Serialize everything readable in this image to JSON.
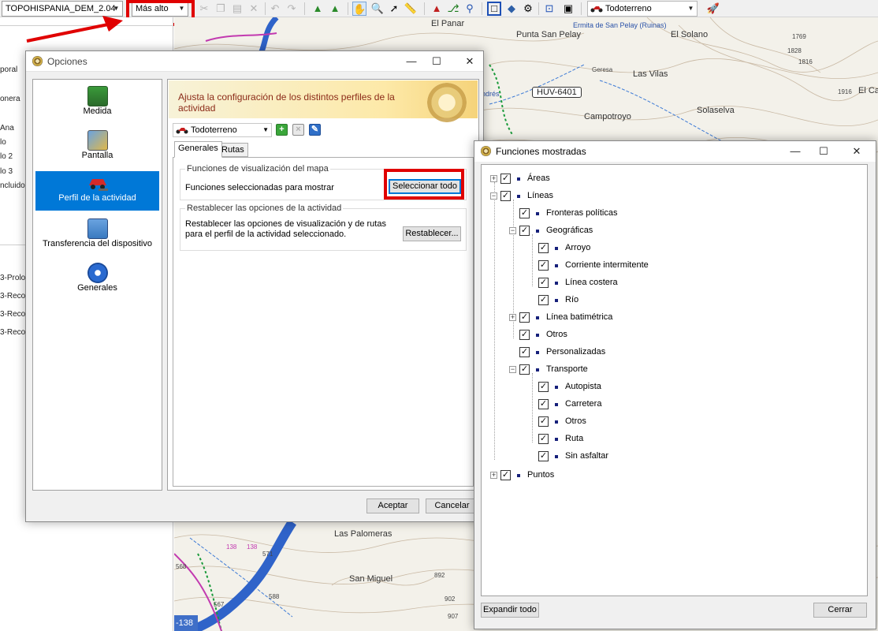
{
  "toolbar": {
    "map_combo": "TOPOHISPANIA_DEM_2.04",
    "detail_combo": "Más alto",
    "profile_combo": "Todoterreno"
  },
  "left_panel": {
    "rows_top": [
      "poral",
      "onera",
      "Ana",
      "lo",
      "lo 2",
      "lo 3",
      "ncluido"
    ],
    "rows_bottom": [
      "3-Prolo",
      "3-Reco",
      "3-Reco",
      "3-Reco"
    ]
  },
  "map": {
    "labels": [
      "El Panar",
      "Punta San Pelay",
      "Ermita de San Pelay (Ruinas)",
      "El Solano",
      "Geresa",
      "Las Vilas",
      "Campotroyo",
      "Solaselva",
      "El Ca",
      "Las Palomeras",
      "San Miguel",
      "ndrés"
    ],
    "road_badge": "HUV-6401",
    "elevations": [
      "1769",
      "1828",
      "1816",
      "1916",
      "568",
      "567",
      "588",
      "571",
      "892",
      "902",
      "907",
      "138",
      "138"
    ],
    "bottom_badge": "-138"
  },
  "opciones": {
    "title": "Opciones",
    "categories": [
      "Medida",
      "Pantalla",
      "Perfil de la actividad",
      "Transferencia del dispositivo",
      "Generales"
    ],
    "banner": "Ajusta la configuración de los distintos perfiles de la actividad",
    "profile": "Todoterreno",
    "tabs": [
      "Generales",
      "Rutas"
    ],
    "group1_title": "Funciones de visualización del mapa",
    "group1_text": "Funciones seleccionadas para mostrar",
    "select_all": "Seleccionar todo",
    "group2_title": "Restablecer las opciones de la actividad",
    "group2_text": "Restablecer las opciones de visualización y de rutas para el perfil de la actividad seleccionado.",
    "reset_button": "Restablecer...",
    "accept": "Aceptar",
    "cancel": "Cancelar"
  },
  "funciones": {
    "title": "Funciones mostradas",
    "tree": [
      {
        "label": "Áreas",
        "level": 0,
        "expander": "+"
      },
      {
        "label": "Líneas",
        "level": 0,
        "expander": "−"
      },
      {
        "label": "Fronteras políticas",
        "level": 1,
        "expander": ""
      },
      {
        "label": "Geográficas",
        "level": 1,
        "expander": "−"
      },
      {
        "label": "Arroyo",
        "level": 2,
        "expander": ""
      },
      {
        "label": "Corriente intermitente",
        "level": 2,
        "expander": ""
      },
      {
        "label": "Línea costera",
        "level": 2,
        "expander": ""
      },
      {
        "label": "Río",
        "level": 2,
        "expander": ""
      },
      {
        "label": "Línea batimétrica",
        "level": 1,
        "expander": "+"
      },
      {
        "label": "Otros",
        "level": 1,
        "expander": ""
      },
      {
        "label": "Personalizadas",
        "level": 1,
        "expander": ""
      },
      {
        "label": "Transporte",
        "level": 1,
        "expander": "−"
      },
      {
        "label": "Autopista",
        "level": 2,
        "expander": ""
      },
      {
        "label": "Carretera",
        "level": 2,
        "expander": ""
      },
      {
        "label": "Otros",
        "level": 2,
        "expander": ""
      },
      {
        "label": "Ruta",
        "level": 2,
        "expander": ""
      },
      {
        "label": "Sin asfaltar",
        "level": 2,
        "expander": ""
      },
      {
        "label": "Puntos",
        "level": 0,
        "expander": "+"
      }
    ],
    "checkmark": "✓",
    "expand_all": "Expandir todo",
    "close": "Cerrar"
  },
  "colors": {
    "highlight": "#e00000",
    "selection": "#0078d7",
    "banner_text": "#8b2a18",
    "river": "#2f63c9"
  }
}
